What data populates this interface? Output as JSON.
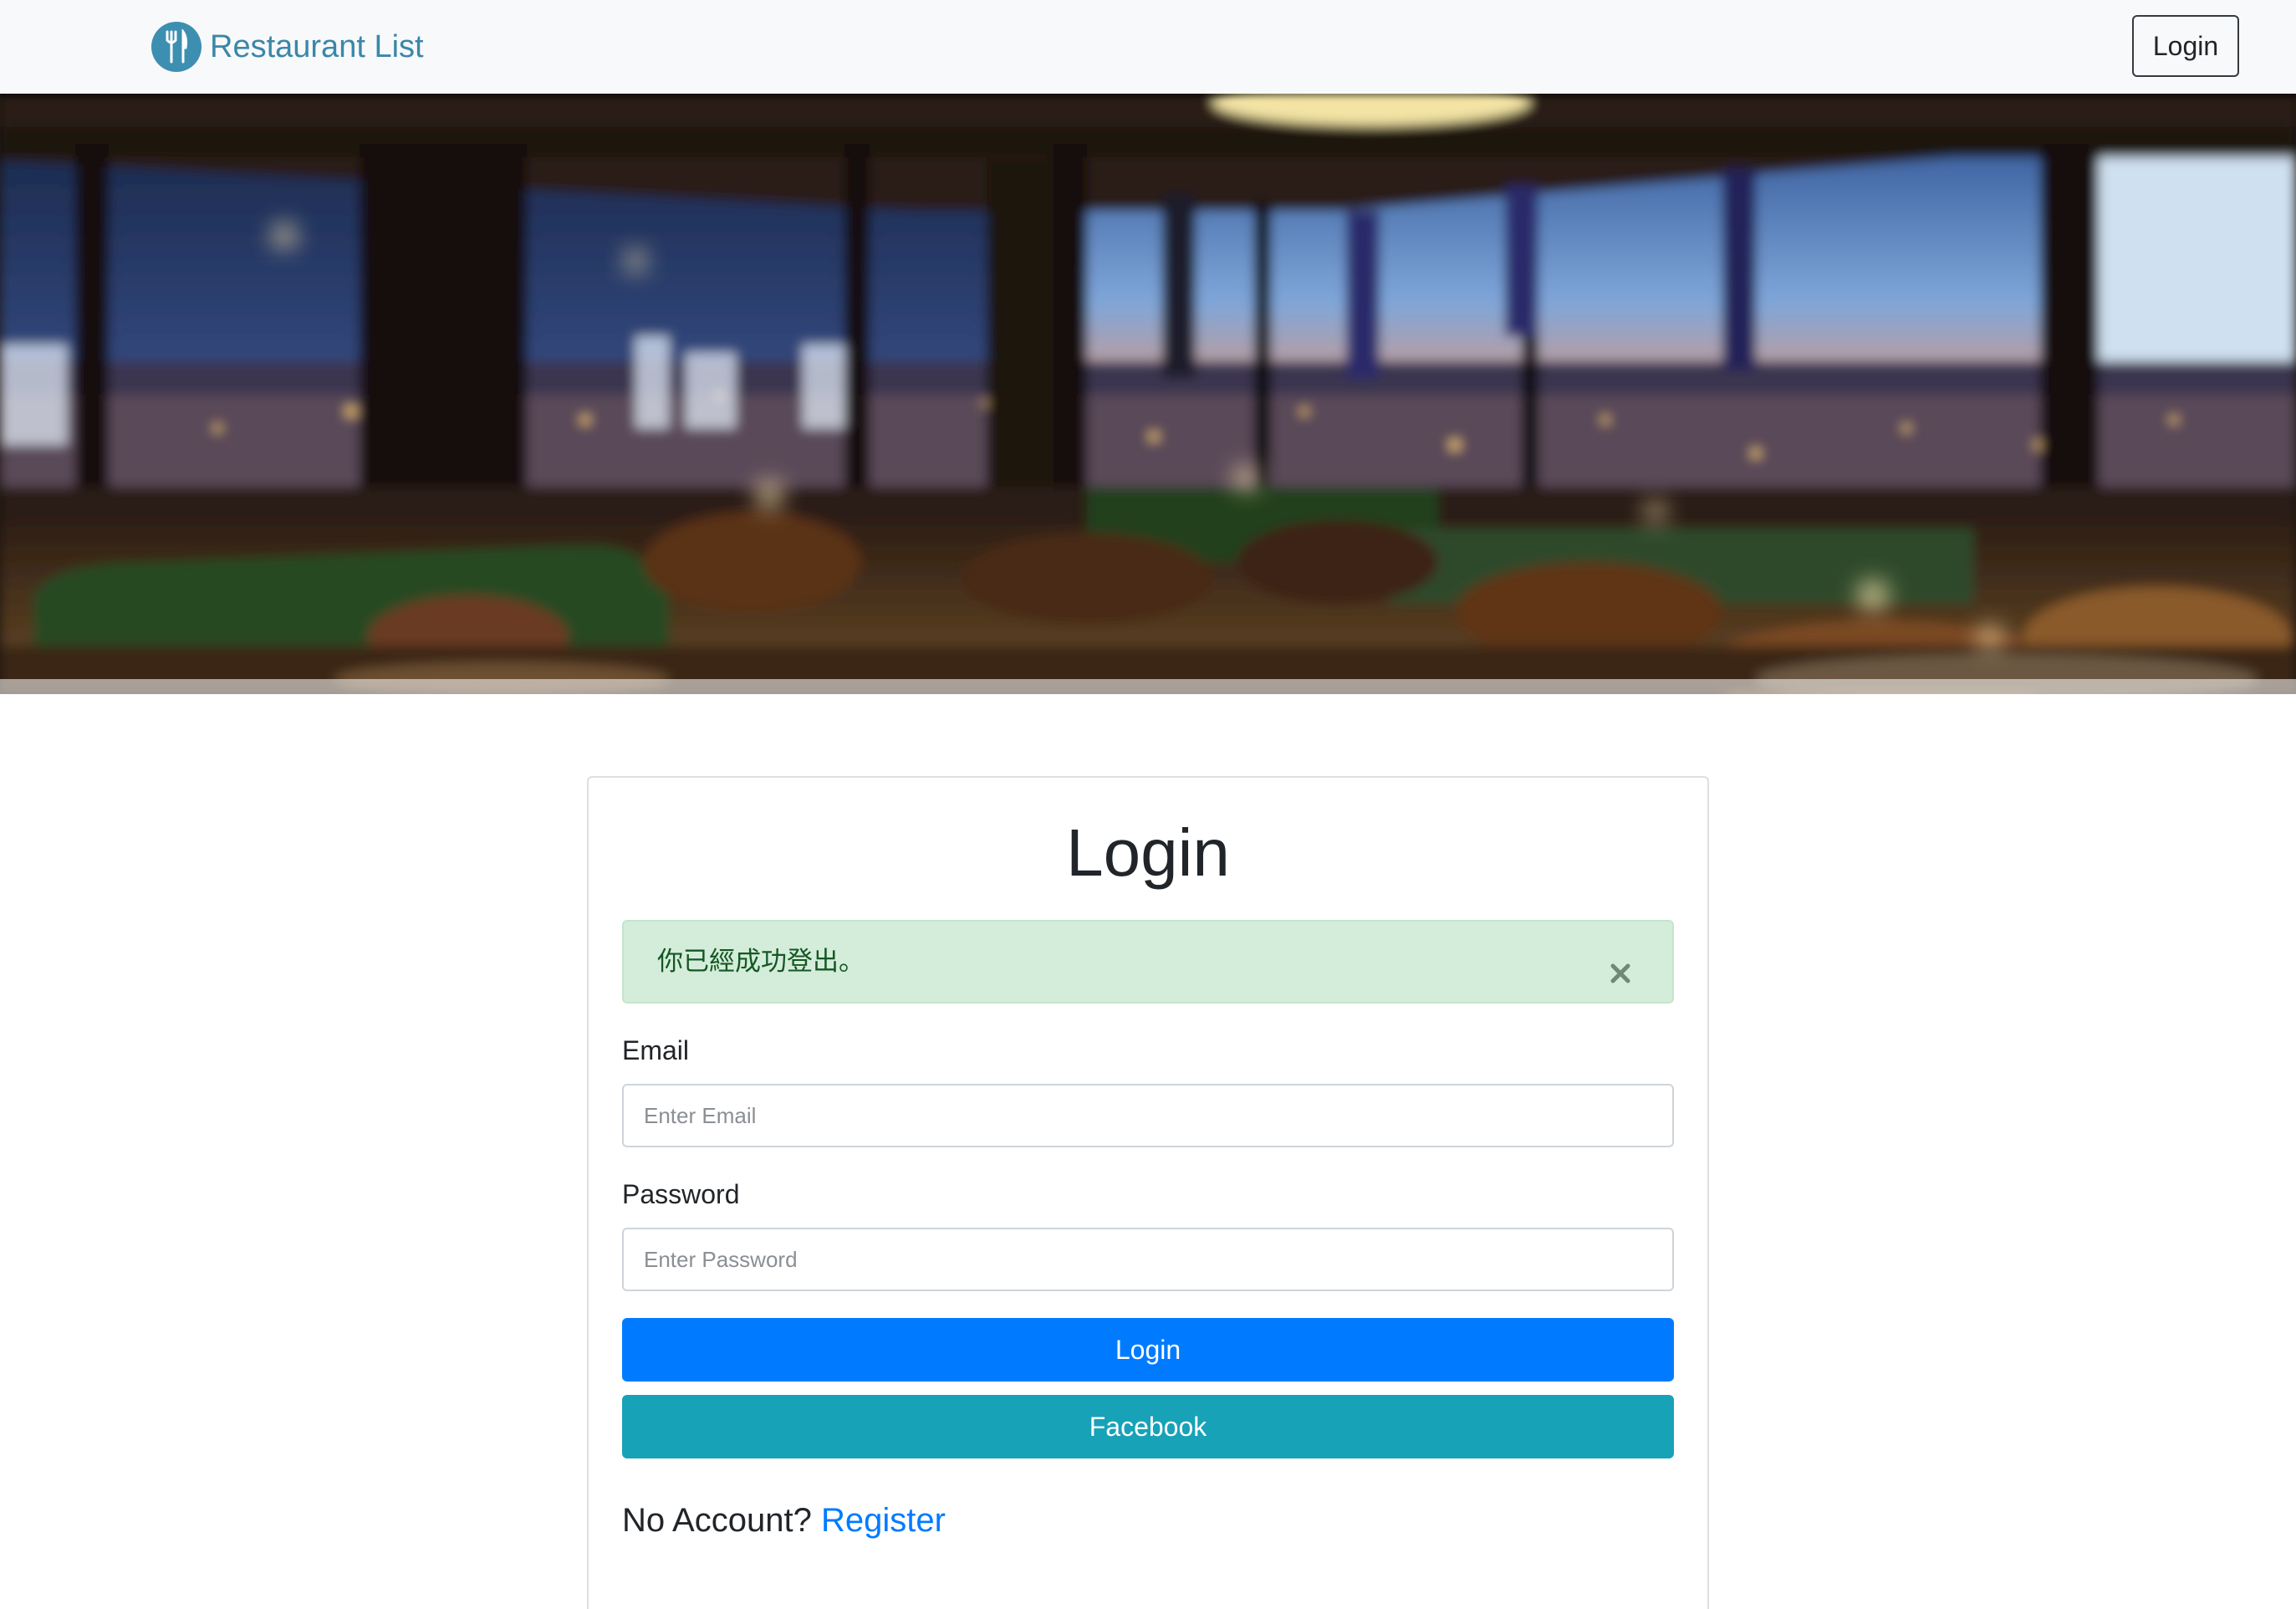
{
  "navbar": {
    "brand": "Restaurant List",
    "brand_icon": "utensils-icon",
    "login_label": "Login"
  },
  "hero": {
    "icon": "restaurant-interior-photo"
  },
  "login_card": {
    "title": "Login",
    "alert": {
      "message": "你已經成功登出。",
      "close_icon": "close-icon"
    },
    "email": {
      "label": "Email",
      "placeholder": "Enter Email",
      "value": ""
    },
    "password": {
      "label": "Password",
      "placeholder": "Enter Password",
      "value": ""
    },
    "login_button": "Login",
    "facebook_button": "Facebook",
    "no_account_text": "No Account?",
    "register_link": "Register"
  },
  "colors": {
    "brand": "#3b87a8",
    "primary": "#007bff",
    "info": "#17a2b8",
    "alert_bg": "#d4edda",
    "alert_text": "#155724"
  }
}
